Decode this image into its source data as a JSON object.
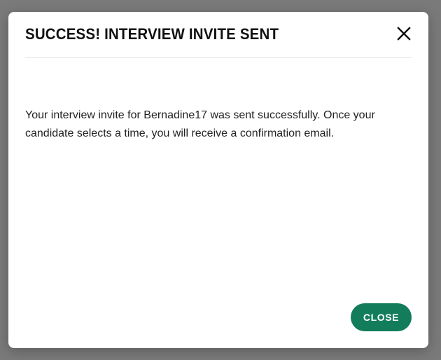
{
  "dialog": {
    "title": "SUCCESS! INTERVIEW INVITE SENT",
    "close_icon": "close-icon",
    "message": "Your interview invite for Bernadine17 was sent successfully. Once your candidate selects a time, you will receive a confirmation email.",
    "close_button_label": "CLOSE"
  },
  "colors": {
    "overlay": "#7a7a7a",
    "dialog_background": "#ffffff",
    "accent": "#137d5b",
    "title_text": "#111111",
    "body_text": "#222222"
  }
}
